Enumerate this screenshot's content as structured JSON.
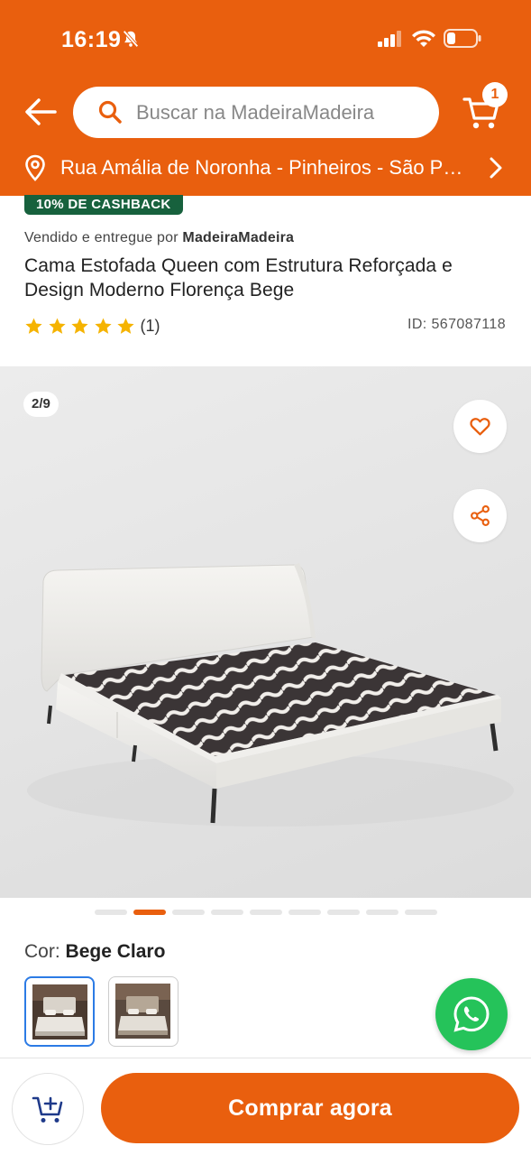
{
  "status_bar": {
    "time": "16:19",
    "icons": [
      "bell-slash-icon",
      "cellular-signal-icon",
      "wifi-icon",
      "battery-icon"
    ]
  },
  "header": {
    "search_placeholder": "Buscar na MadeiraMadeira",
    "cart_count": "1",
    "address": "Rua Amália de Noronha - Pinheiros - São Paulo",
    "brand_color": "#E95F0E"
  },
  "product": {
    "cashback_badge": "10% DE CASHBACK",
    "seller_prefix": "Vendido e entregue por",
    "seller_name": "MadeiraMadeira",
    "title": "Cama Estofada Queen com Estrutura Reforçada e Design Moderno Florença Bege",
    "rating_stars": 5,
    "rating_count": "(1)",
    "product_id": "ID: 567087118"
  },
  "gallery": {
    "counter": "2/9",
    "total_images": 9,
    "active_index": 2,
    "icons": [
      "heart-icon",
      "share-icon"
    ]
  },
  "variant": {
    "label": "Cor:",
    "value": "Bege Claro",
    "options": 2,
    "selected": 1
  },
  "actions": {
    "buy_label": "Comprar agora",
    "icons": [
      "add-to-cart-icon",
      "whatsapp-icon"
    ]
  },
  "colors": {
    "accent": "#E95F0E",
    "cashback_green": "#17613D",
    "star_yellow": "#F5B301",
    "whatsapp_green": "#25C35A",
    "selected_blue": "#2C7BE5"
  }
}
